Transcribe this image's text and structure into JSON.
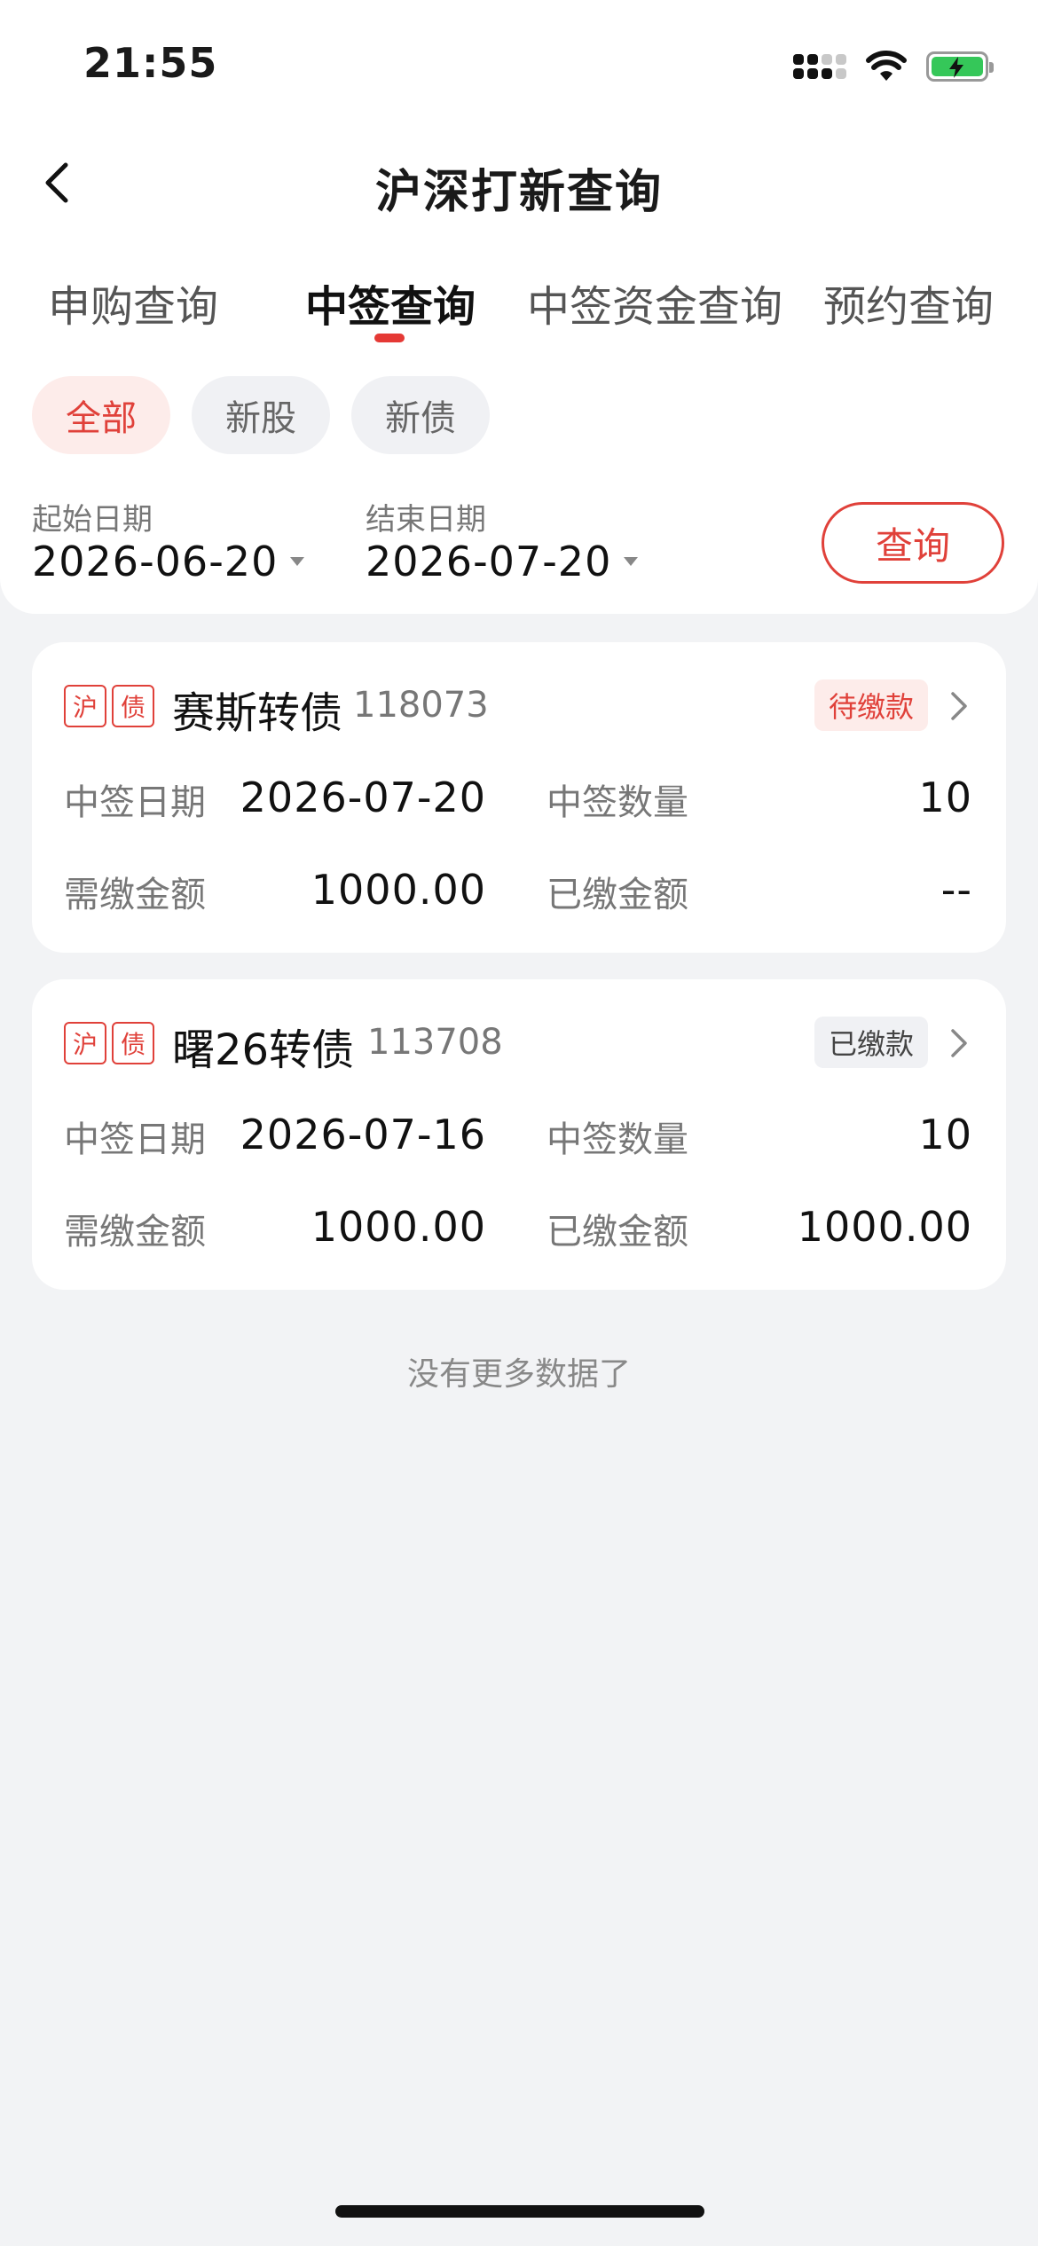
{
  "status_bar": {
    "time": "21:55"
  },
  "header": {
    "title": "沪深打新查询"
  },
  "tabs": [
    {
      "label": "申购查询",
      "active": false
    },
    {
      "label": "中签查询",
      "active": true
    },
    {
      "label": "中签资金查询",
      "active": false
    },
    {
      "label": "预约查询",
      "active": false
    }
  ],
  "filters": [
    {
      "label": "全部",
      "active": true
    },
    {
      "label": "新股",
      "active": false
    },
    {
      "label": "新债",
      "active": false
    }
  ],
  "date_range": {
    "start_label": "起始日期",
    "start_value": "2026-06-20",
    "end_label": "结束日期",
    "end_value": "2026-07-20",
    "query_label": "查询"
  },
  "records": [
    {
      "market_tag": "沪",
      "type_tag": "债",
      "name": "赛斯转债",
      "code": "118073",
      "status": "待缴款",
      "win_date_label": "中签日期",
      "win_date": "2026-07-20",
      "win_qty_label": "中签数量",
      "win_qty": "10",
      "due_label": "需缴金额",
      "due_amount": "1000.00",
      "paid_label": "已缴金额",
      "paid_amount": "--"
    },
    {
      "market_tag": "沪",
      "type_tag": "债",
      "name": "曙26转债",
      "code": "113708",
      "status": "已缴款",
      "win_date_label": "中签日期",
      "win_date": "2026-07-16",
      "win_qty_label": "中签数量",
      "win_qty": "10",
      "due_label": "需缴金额",
      "due_amount": "1000.00",
      "paid_label": "已缴金额",
      "paid_amount": "1000.00"
    }
  ],
  "footer": {
    "no_more": "没有更多数据了"
  },
  "colors": {
    "accent": "#e0413a",
    "background": "#f2f3f5",
    "card": "#ffffff"
  }
}
